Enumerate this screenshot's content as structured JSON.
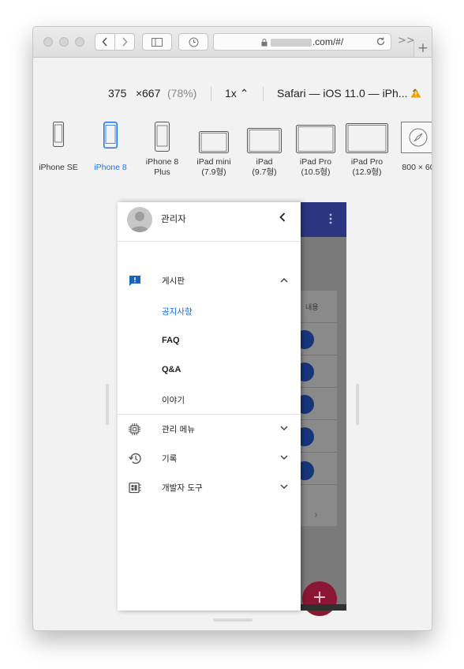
{
  "browser": {
    "url_suffix": ".com/#/",
    "more_label": ">>",
    "new_tab_label": "+"
  },
  "responsive": {
    "width": "375",
    "times": "×",
    "height": "667",
    "zoom": "(78%)",
    "scale": "1x ⌃",
    "user_agent": "Safari — iOS 11.0 — iPh... ⌃"
  },
  "devices": [
    {
      "name": "iPhone SE",
      "sub": ""
    },
    {
      "name": "iPhone 8",
      "sub": "",
      "active": true
    },
    {
      "name": "iPhone 8",
      "sub": "Plus"
    },
    {
      "name": "iPad mini",
      "sub": "(7.9형)"
    },
    {
      "name": "iPad",
      "sub": "(9.7형)"
    },
    {
      "name": "iPad Pro",
      "sub": "(10.5형)"
    },
    {
      "name": "iPad Pro",
      "sub": "(12.9형)"
    },
    {
      "name": "800 × 60",
      "sub": ""
    }
  ],
  "drawer": {
    "user": "관리자",
    "menu": [
      {
        "label": "게시판",
        "icon": "announcement-icon",
        "expanded": true,
        "children": [
          {
            "label": "공지사항",
            "active": true
          },
          {
            "label": "FAQ"
          },
          {
            "label": "Q&A"
          },
          {
            "label": "이야기"
          }
        ]
      },
      {
        "label": "관리 메뉴",
        "icon": "chip-icon"
      },
      {
        "label": "기록",
        "icon": "history-icon"
      },
      {
        "label": "개발자 도구",
        "icon": "developer-board-icon"
      }
    ]
  },
  "app": {
    "column_header": "내용",
    "fab_label": "+",
    "row_chevron": "›",
    "colors": {
      "appbar": "#2c3580",
      "fab": "#c2185b",
      "active_link": "#1b6bd8"
    }
  }
}
